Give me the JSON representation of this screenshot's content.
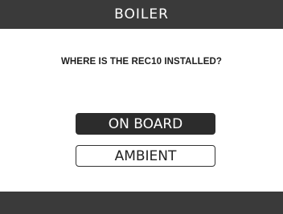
{
  "header": {
    "title": "BOILER"
  },
  "prompt": {
    "question": "WHERE IS THE REC10 INSTALLED?"
  },
  "options": [
    {
      "label": "ON BOARD",
      "selected": true
    },
    {
      "label": "AMBIENT",
      "selected": false
    }
  ],
  "colors": {
    "bar": "#3a3a3a",
    "selected_fill": "#2c2c2c",
    "background": "#ffffff"
  }
}
